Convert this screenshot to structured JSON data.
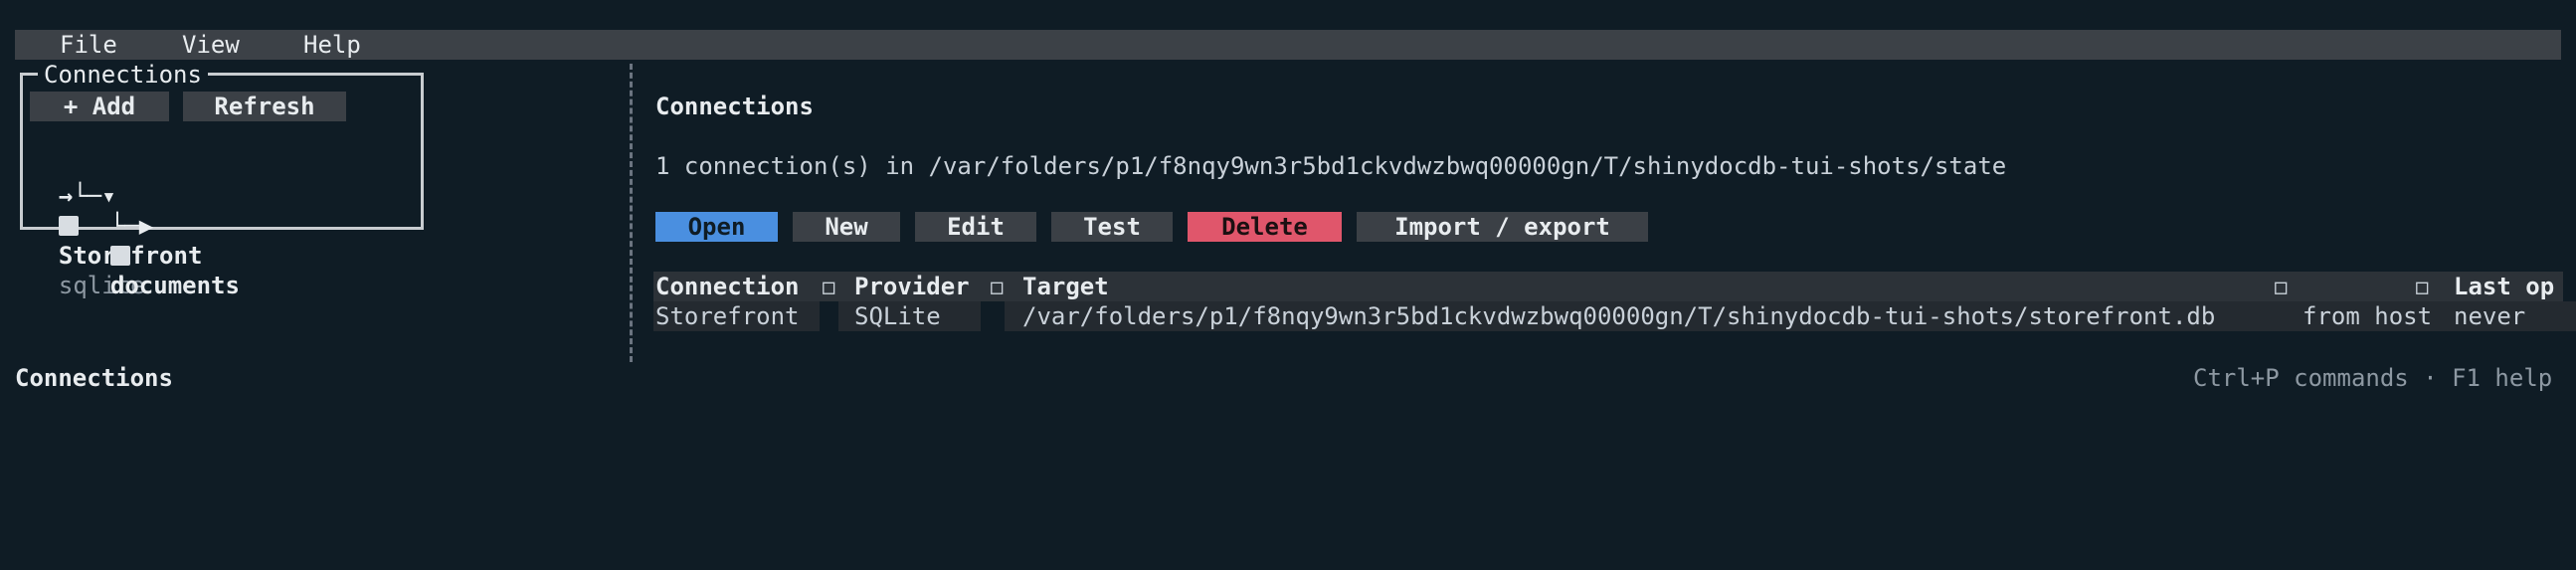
{
  "menu": {
    "file": "File",
    "view": "View",
    "help": "Help"
  },
  "sidebar": {
    "title": "Connections",
    "add_label": "+ Add",
    "refresh_label": "Refresh",
    "tree": {
      "root_prefix": "→└─▾",
      "root_name": "Storefront",
      "root_provider": "sqlite",
      "child_prefix": "└─▶",
      "child_name": "documents"
    }
  },
  "main": {
    "title": "Connections",
    "summary": "1 connection(s) in /var/folders/p1/f8nqy9wn3r5bd1ckvdwzbwq00000gn/T/shinydocdb-tui-shots/state",
    "actions": {
      "open": "Open",
      "new": "New",
      "edit": "Edit",
      "test": "Test",
      "delete": "Delete",
      "import_export": "Import / export"
    },
    "table": {
      "headers": [
        "Connection",
        "Provider",
        "Target",
        "",
        "Last op"
      ],
      "sort_icon": "◻",
      "rows": [
        {
          "connection": "Storefront",
          "provider": "SQLite",
          "target": "/var/folders/p1/f8nqy9wn3r5bd1ckvdwzbwq00000gn/T/shinydocdb-tui-shots/storefront.db",
          "mode": "from host",
          "last_op": "never"
        }
      ]
    }
  },
  "statusbar": {
    "left": "Connections",
    "right": "Ctrl+P commands · F1 help"
  },
  "colors": {
    "background": "#0f1c25",
    "primary": "#4a8fe0",
    "danger": "#e0566b",
    "button": "#3b4046"
  }
}
